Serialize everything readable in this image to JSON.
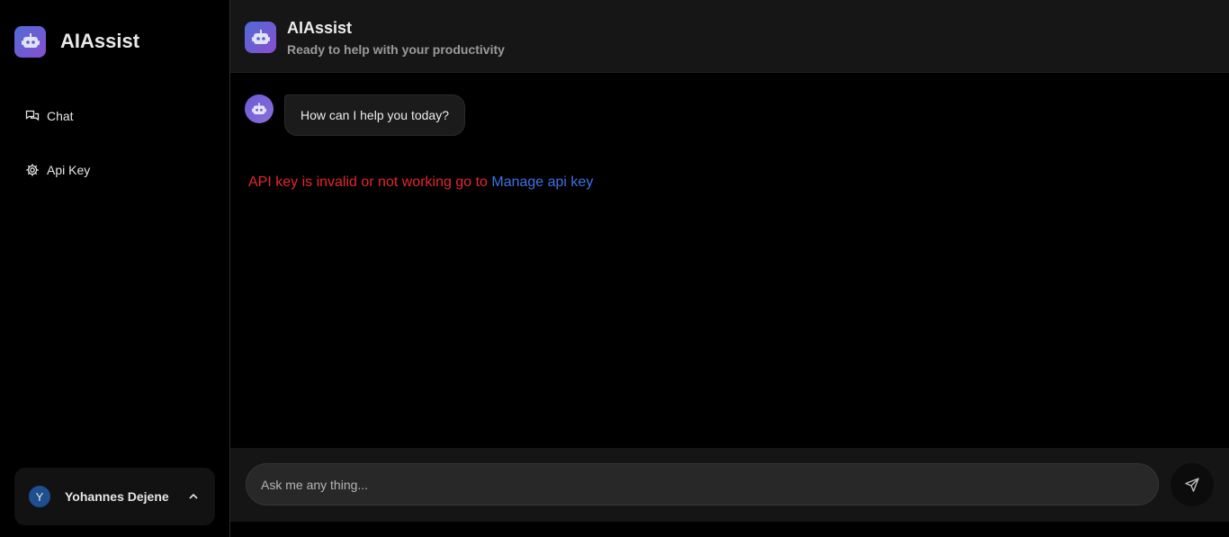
{
  "sidebar": {
    "brand_title": "AIAssist",
    "brand_icon": "robot-icon",
    "items": [
      {
        "label": "Chat",
        "icon": "chat-icon"
      },
      {
        "label": "Api Key",
        "icon": "gear-icon"
      }
    ],
    "user": {
      "initial": "Y",
      "name": "Yohannes Dejene",
      "chevron_icon": "chevron-up-icon"
    }
  },
  "header": {
    "title": "AIAssist",
    "subtitle": "Ready to help with your productivity",
    "icon": "robot-icon"
  },
  "messages": [
    {
      "role": "assistant",
      "text": "How can I help you today?"
    }
  ],
  "error": {
    "text": "API key is invalid or not working go to ",
    "link_text": "Manage api key"
  },
  "composer": {
    "placeholder": "Ask me any thing...",
    "send_icon": "send-icon"
  },
  "colors": {
    "error": "#e5262b",
    "link": "#3b73e6",
    "accent_gradient_start": "#4f6bd6",
    "accent_gradient_end": "#8a4fd0"
  }
}
